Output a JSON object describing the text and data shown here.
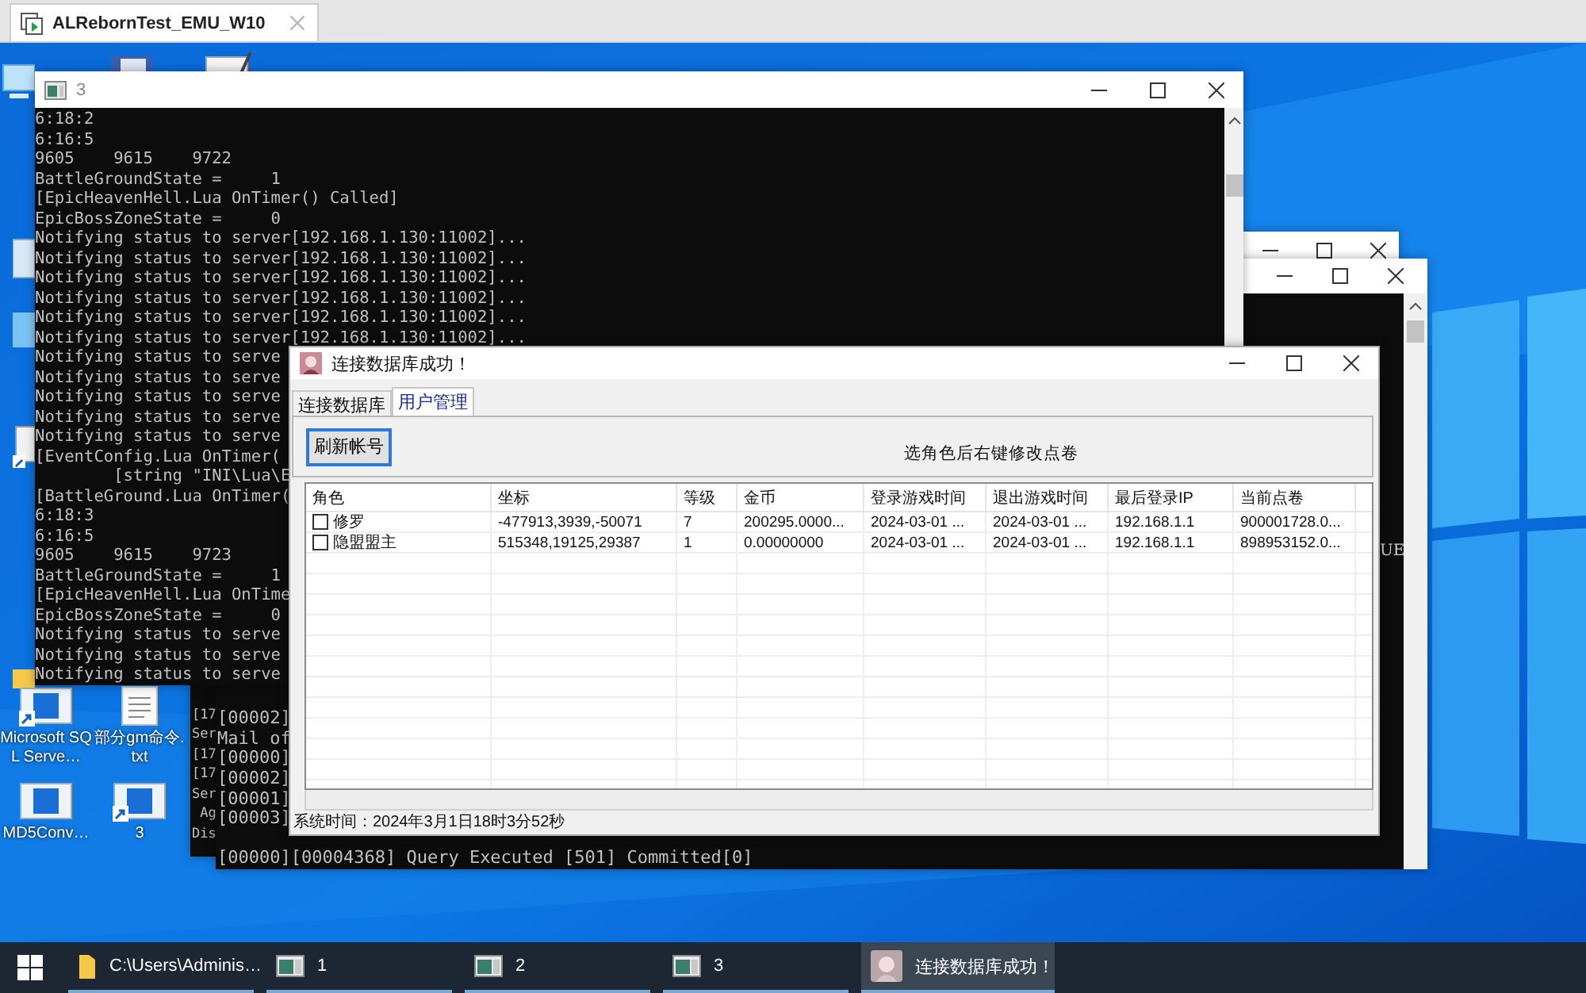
{
  "vm_tab": {
    "title": "ALRebornTest_EMU_W10"
  },
  "desktop_icons": [
    {
      "label": "Microsoft SQL Serve…",
      "kind": "app",
      "shortcut": true
    },
    {
      "label": "部分gm命令.txt",
      "kind": "text-file",
      "shortcut": false
    },
    {
      "label": "MD5Conv…",
      "kind": "app",
      "shortcut": false
    },
    {
      "label": "3",
      "kind": "app",
      "shortcut": true
    }
  ],
  "back_console_1": {
    "lines": [
      "[17",
      "Ser",
      "[17",
      "[17",
      "Ser",
      " Ag",
      "Dis"
    ]
  },
  "back_console_2": {
    "edge_text": "UE",
    "lines": [
      "[00002]",
      "Mail of",
      "[00000]",
      "[00002]",
      "[00001]",
      "[00003]"
    ],
    "last_line": "[00000][00004368] Query Executed [501] Committed[0]"
  },
  "console_window": {
    "title": "3",
    "lines": [
      "6:18:2",
      "6:16:5",
      "9605    9615    9722",
      "BattleGroundState =     1",
      "[EpicHeavenHell.Lua OnTimer() Called]",
      "EpicBossZoneState =     0",
      "Notifying status to server[192.168.1.130:11002]...",
      "Notifying status to server[192.168.1.130:11002]...",
      "Notifying status to server[192.168.1.130:11002]...",
      "Notifying status to server[192.168.1.130:11002]...",
      "Notifying status to server[192.168.1.130:11002]...",
      "Notifying status to server[192.168.1.130:11002]...",
      "Notifying status to serve",
      "Notifying status to serve",
      "Notifying status to serve",
      "Notifying status to serve",
      "Notifying status to serve",
      "[EventConfig.Lua OnTimer(",
      "        [string \"INI\\Lua\\E",
      "[BattleGround.Lua OnTimer(",
      "6:18:3",
      "6:16:5",
      "9605    9615    9723",
      "BattleGroundState =     1",
      "[EpicHeavenHell.Lua OnTime",
      "EpicBossZoneState =     0",
      "Notifying status to serve",
      "Notifying status to serve",
      "Notifying status to serve"
    ]
  },
  "dialog": {
    "title": "连接数据库成功！",
    "tabs": [
      {
        "label": "连接数据库",
        "selected": false
      },
      {
        "label": "用户管理",
        "selected": true
      }
    ],
    "refresh_button": "刷新帐号",
    "hint": "选角色后右键修改点卷",
    "table": {
      "columns": [
        "角色",
        "坐标",
        "等级",
        "金币",
        "登录游戏时间",
        "退出游戏时间",
        "最后登录IP",
        "当前点卷"
      ],
      "rows": [
        {
          "checked": false,
          "cells": [
            "修罗",
            "-477913,3939,-50071",
            "7",
            "200295.0000...",
            "2024-03-01 ...",
            "2024-03-01 ...",
            "192.168.1.1",
            "900001728.0..."
          ]
        },
        {
          "checked": false,
          "cells": [
            "隐盟盟主",
            "515348,19125,29387",
            "1",
            "0.00000000",
            "2024-03-01 ...",
            "2024-03-01 ...",
            "192.168.1.1",
            "898953152.0..."
          ]
        }
      ]
    },
    "status": "系统时间：2024年3月1日18时3分52秒"
  },
  "taskbar": {
    "items": [
      {
        "label": "C:\\Users\\Adminis…",
        "kind": "folder",
        "selected": false
      },
      {
        "label": "1",
        "kind": "console",
        "selected": false
      },
      {
        "label": "2",
        "kind": "console",
        "selected": false
      },
      {
        "label": "3",
        "kind": "console",
        "selected": false
      },
      {
        "label": "连接数据库成功！",
        "kind": "app",
        "selected": true
      }
    ]
  }
}
